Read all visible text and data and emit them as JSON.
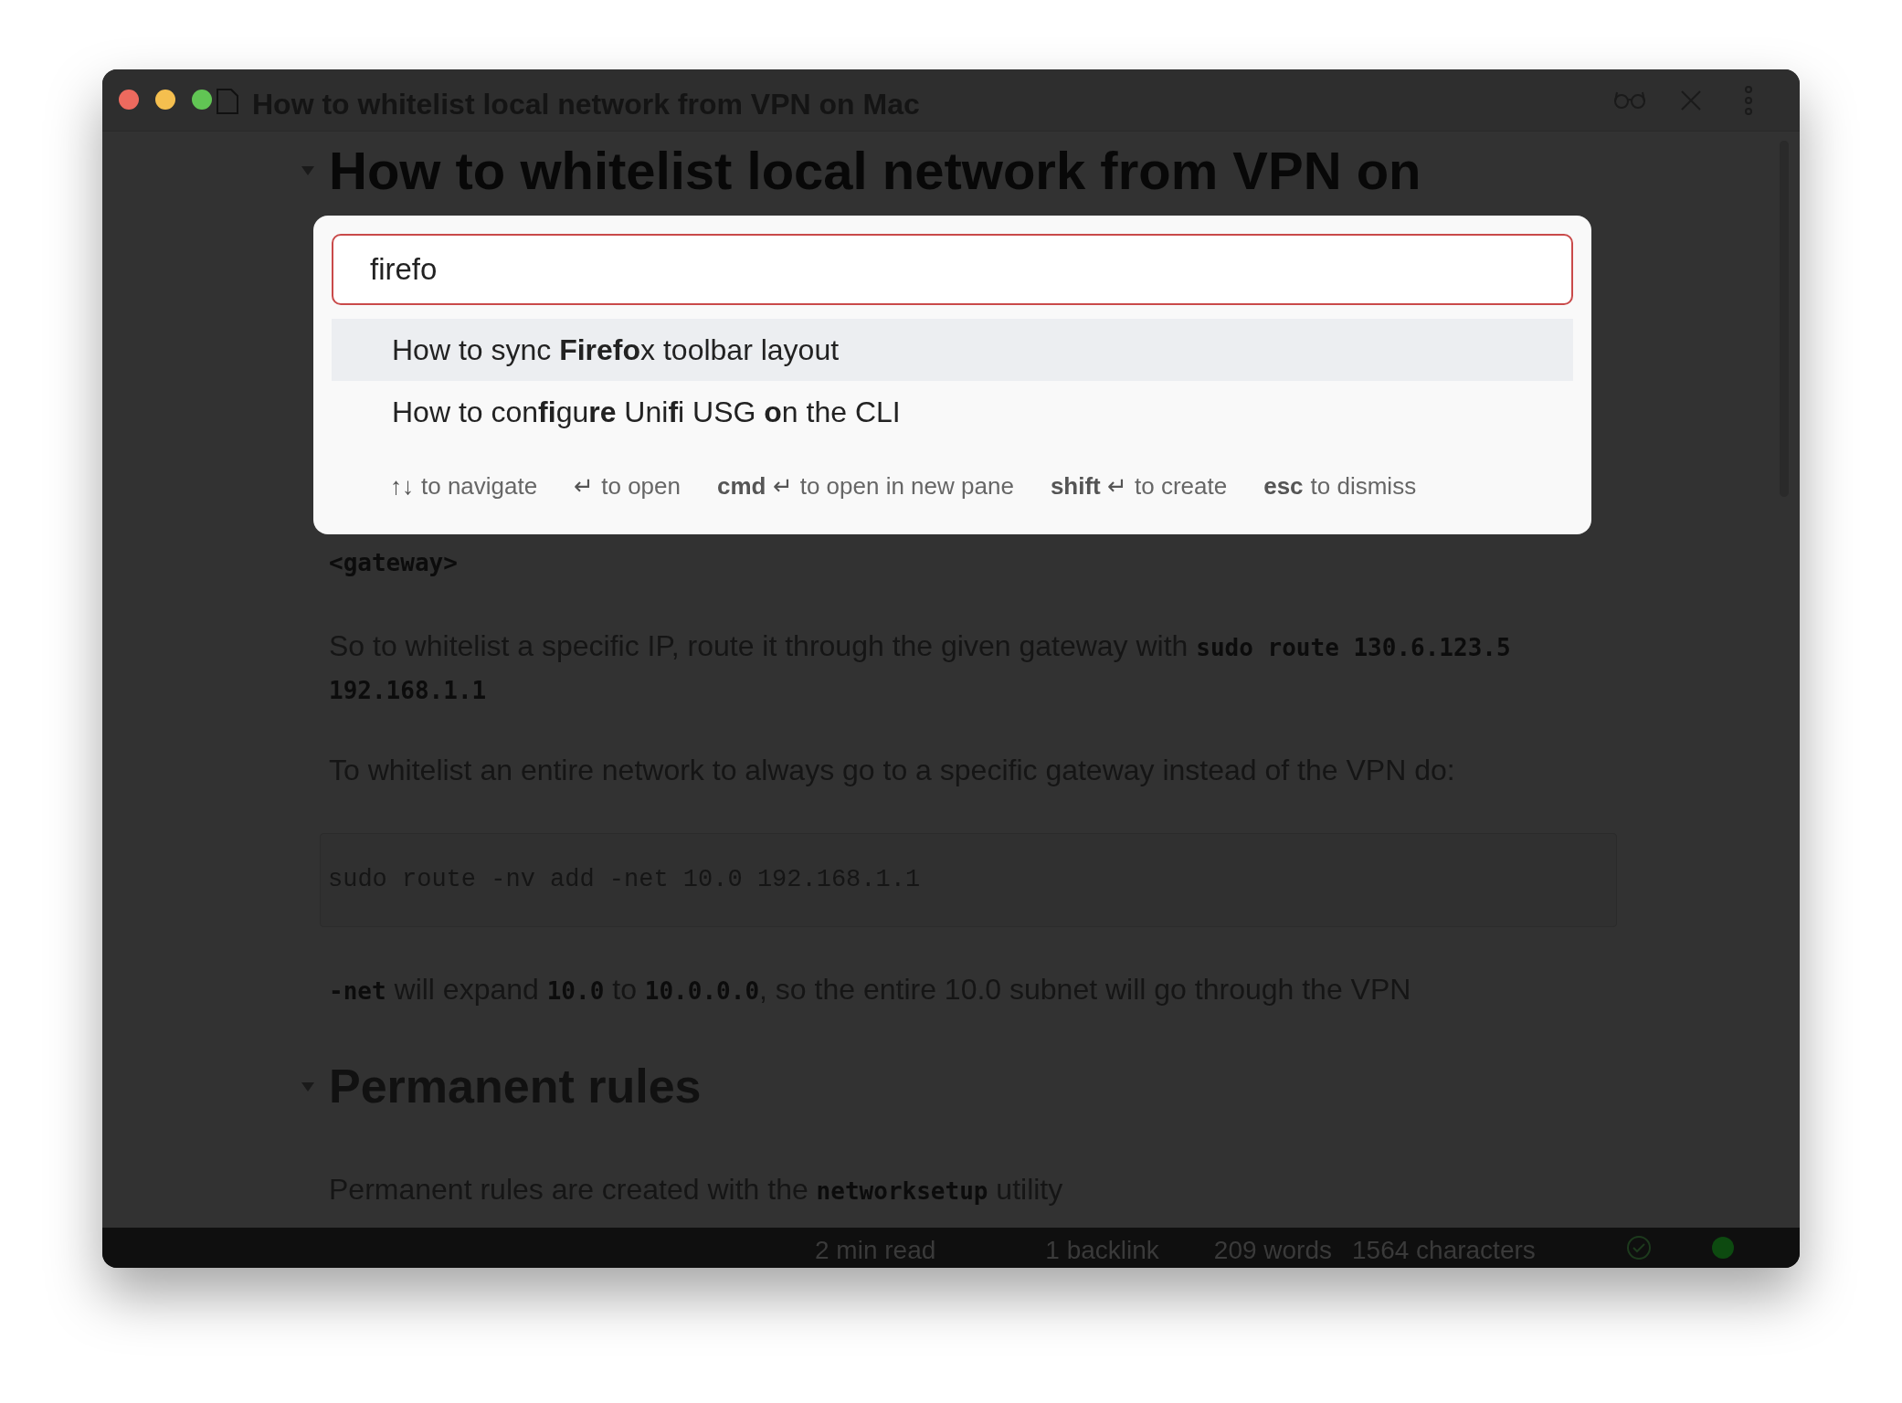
{
  "window": {
    "title": "How to whitelist local network from VPN on Mac"
  },
  "note": {
    "heading": "How to whitelist local network from VPN on",
    "blocks": [
      {
        "kind": "paragraph",
        "segments": [
          {
            "kind": "code",
            "text": "<gateway>"
          }
        ]
      },
      {
        "kind": "paragraph",
        "segments": [
          {
            "kind": "text",
            "text": "So to whitelist a specific IP, route it through the given gateway with "
          },
          {
            "kind": "code",
            "text": "sudo route 130.6.123.5 192.168.1.1"
          }
        ]
      },
      {
        "kind": "paragraph",
        "segments": [
          {
            "kind": "text",
            "text": "To whitelist an entire network to always go to a specific gateway instead of the VPN do:"
          }
        ]
      },
      {
        "kind": "codeblock",
        "text": "sudo route -nv add -net 10.0 192.168.1.1"
      },
      {
        "kind": "paragraph",
        "segments": [
          {
            "kind": "code",
            "text": "-net"
          },
          {
            "kind": "text",
            "text": " will expand "
          },
          {
            "kind": "code",
            "text": "10.0"
          },
          {
            "kind": "text",
            "text": " to "
          },
          {
            "kind": "code",
            "text": "10.0.0.0"
          },
          {
            "kind": "text",
            "text": ", so the entire 10.0 subnet will go through the VPN"
          }
        ]
      },
      {
        "kind": "heading",
        "text": "Permanent rules",
        "expanded": true
      },
      {
        "kind": "paragraph",
        "segments": [
          {
            "kind": "text",
            "text": "Permanent rules are created with the "
          },
          {
            "kind": "code",
            "text": "networksetup"
          },
          {
            "kind": "text",
            "text": " utility"
          }
        ]
      }
    ]
  },
  "switcher": {
    "query": "firefo",
    "results": [
      {
        "title": "How to sync **Firefo**x toolbar layout",
        "selected": true
      },
      {
        "title": "How to con**fi**gu**re** Uni**f**i USG **o**n the CLI",
        "selected": false
      }
    ],
    "hints": [
      {
        "key": "↑↓",
        "label": "to navigate"
      },
      {
        "key": "↵",
        "label": "to open"
      },
      {
        "key": "**cmd** ↵",
        "label": "to open in new pane"
      },
      {
        "key": "**shift** ↵",
        "label": "to create"
      },
      {
        "key": "**esc**",
        "label": "to dismiss"
      }
    ]
  },
  "status_bar": {
    "items": [
      "2 min read",
      "1 backlink",
      "209 words",
      "1564 characters"
    ]
  }
}
